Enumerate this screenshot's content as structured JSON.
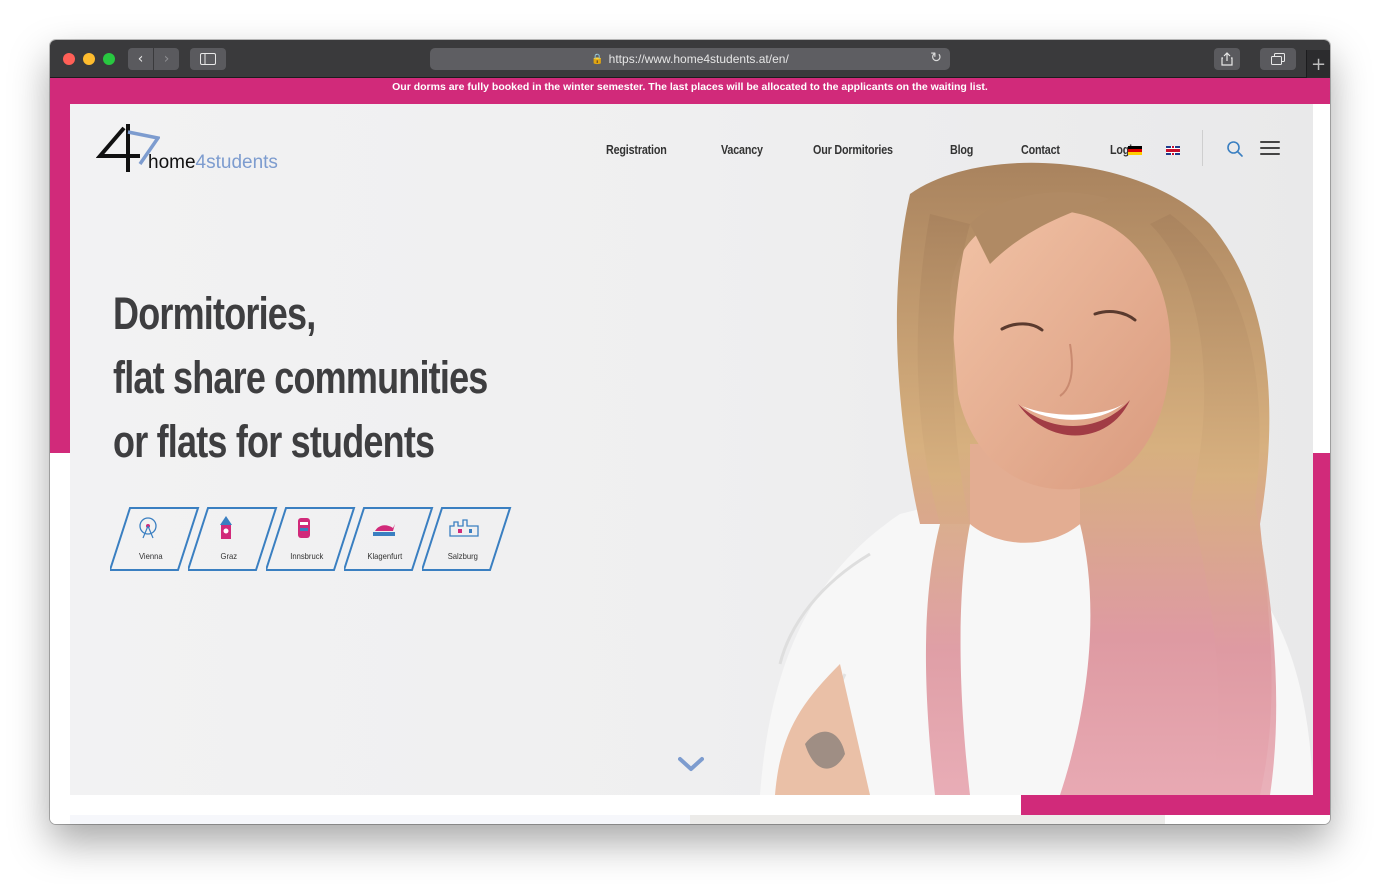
{
  "browser": {
    "url": "https://www.home4students.at/en/",
    "colors": {
      "toolbar": "#3a3a3c",
      "close": "#ff5f57",
      "minimize": "#febc2e",
      "zoom": "#28c840"
    }
  },
  "banner": {
    "text": "Our dorms are fully booked in the winter semester. The last places will be allocated to the applicants on the waiting list."
  },
  "brand": {
    "name_part1": "home",
    "name_part2": "4students",
    "colors": {
      "pink": "#d12a7a",
      "blue": "#7d9ccf",
      "city_frame": "#3a7fc1"
    }
  },
  "nav": {
    "items": [
      {
        "label": "Registration"
      },
      {
        "label": "Vacancy"
      },
      {
        "label": "Our Dormitories"
      },
      {
        "label": "Blog"
      },
      {
        "label": "Contact"
      },
      {
        "label": "Login"
      }
    ],
    "languages": [
      "de-flag-icon",
      "uk-flag-icon"
    ]
  },
  "hero": {
    "headline": [
      "Dormitories,",
      "flat share communities",
      "or flats for students"
    ],
    "cities": [
      {
        "label": "Vienna",
        "icon": "ferris-wheel-icon"
      },
      {
        "label": "Graz",
        "icon": "clock-tower-icon"
      },
      {
        "label": "Innsbruck",
        "icon": "golden-roof-icon"
      },
      {
        "label": "Klagenfurt",
        "icon": "dragon-icon"
      },
      {
        "label": "Salzburg",
        "icon": "fortress-icon"
      }
    ]
  }
}
